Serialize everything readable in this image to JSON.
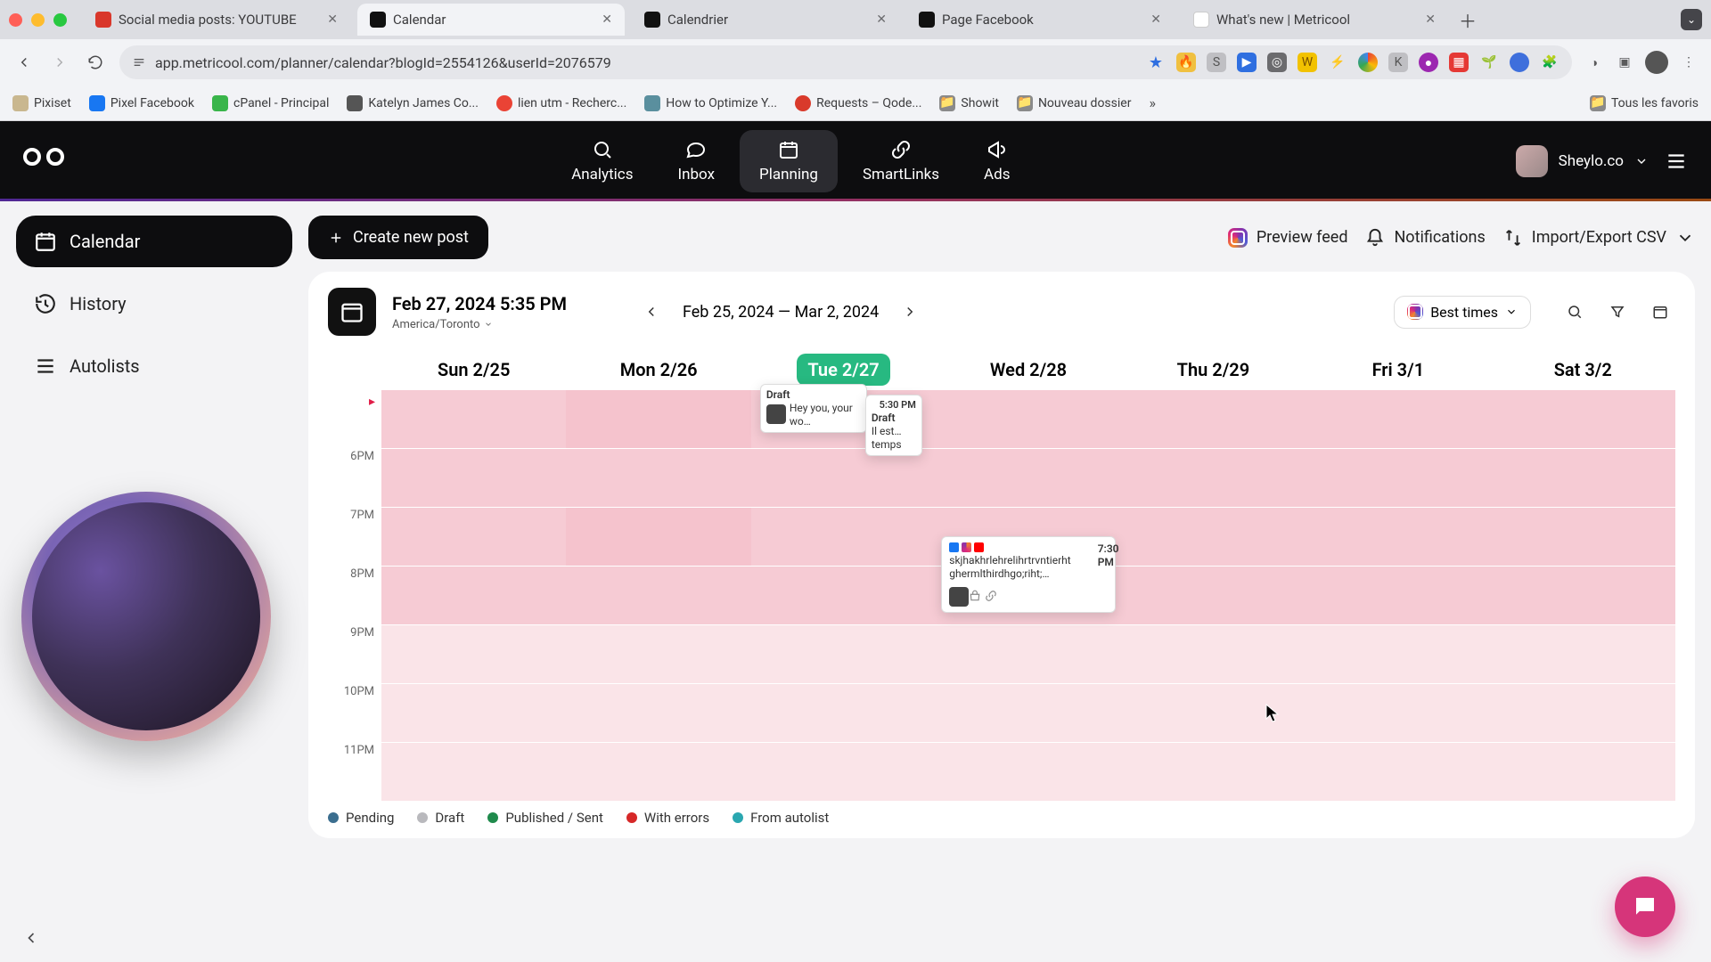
{
  "browser": {
    "tabs": [
      {
        "title": "Social media posts: YOUTUBE",
        "favicon": "#d9372b"
      },
      {
        "title": "Calendar",
        "favicon": "#111111",
        "active": true
      },
      {
        "title": "Calendrier",
        "favicon": "#111111"
      },
      {
        "title": "Page Facebook",
        "favicon": "#111111"
      },
      {
        "title": "What's new | Metricool",
        "favicon": "#ffffff"
      }
    ],
    "url": "app.metricool.com/planner/calendar?blogId=2554126&userId=2076579",
    "bookmarks": [
      {
        "label": "Pixiset",
        "color": "#c9b78f"
      },
      {
        "label": "Pixel Facebook",
        "color": "#1877f2"
      },
      {
        "label": "cPanel - Principal",
        "color": "#39b54a"
      },
      {
        "label": "Katelyn James Co...",
        "color": "#555555"
      },
      {
        "label": "lien utm - Recherc...",
        "color": "#ea4335"
      },
      {
        "label": "How to Optimize Y...",
        "color": "#5a8f9e"
      },
      {
        "label": "Requests – Qode...",
        "color": "#d93a2b"
      },
      {
        "label": "Showit",
        "color": "#8a8a8a"
      },
      {
        "label": "Nouveau dossier",
        "color": "#8a8a8a"
      }
    ],
    "all_bookmarks_label": "Tous les favoris"
  },
  "app": {
    "nav": {
      "analytics": "Analytics",
      "inbox": "Inbox",
      "planning": "Planning",
      "smartlinks": "SmartLinks",
      "ads": "Ads"
    },
    "account_name": "Sheylo.co",
    "sidebar": {
      "calendar": "Calendar",
      "history": "History",
      "autolists": "Autolists"
    },
    "create_new_post": "Create new post",
    "preview_feed": "Preview feed",
    "notifications": "Notifications",
    "import_export": "Import/Export CSV",
    "best_times": "Best times"
  },
  "calendar": {
    "current_dt": "Feb 27, 2024 5:35 PM",
    "timezone": "America/Toronto",
    "range_label": "Feb 25, 2024 — Mar 2, 2024",
    "days": [
      "Sun 2/25",
      "Mon 2/26",
      "Tue 2/27",
      "Wed 2/28",
      "Thu 2/29",
      "Fri 3/1",
      "Sat 3/2"
    ],
    "today_index": 2,
    "slot_labels": [
      "",
      "6PM",
      "7PM",
      "8PM",
      "9PM",
      "10PM",
      "11PM"
    ],
    "events": {
      "tue1": {
        "time": "",
        "status": "Draft",
        "text": "Hey you, your wo…"
      },
      "tue2": {
        "time": "5:30 PM",
        "status": "Draft",
        "text": "Il est… temps"
      },
      "wed1": {
        "time": "7:30 PM",
        "text": "skjhakhrlehrelihrtrvntierht ghermlthirdhgo;riht;…"
      }
    },
    "legend": {
      "pending": "Pending",
      "draft": "Draft",
      "published": "Published / Sent",
      "errors": "With errors",
      "autolist": "From autolist"
    }
  }
}
